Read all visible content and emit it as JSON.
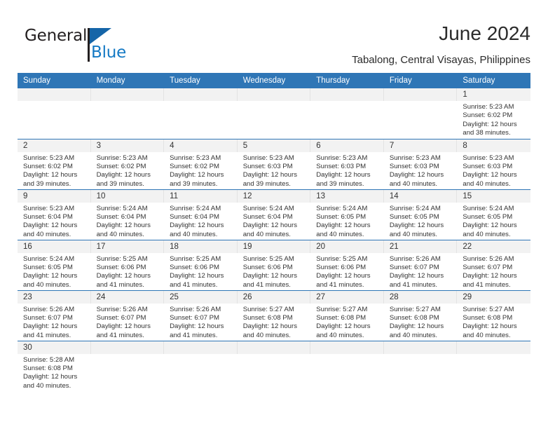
{
  "branding": {
    "logo_primary": "General",
    "logo_secondary": "Blue",
    "logo_flag_icon": "flag-triangle-icon",
    "accent_color": "#2f76b6",
    "logo_blue_color": "#1479c4"
  },
  "header": {
    "title": "June 2024",
    "subtitle": "Tabalong, Central Visayas, Philippines"
  },
  "calendar": {
    "weekday_headers": [
      "Sunday",
      "Monday",
      "Tuesday",
      "Wednesday",
      "Thursday",
      "Friday",
      "Saturday"
    ],
    "weeks": [
      [
        {
          "day": "",
          "empty": true,
          "lines": []
        },
        {
          "day": "",
          "empty": true,
          "lines": []
        },
        {
          "day": "",
          "empty": true,
          "lines": []
        },
        {
          "day": "",
          "empty": true,
          "lines": []
        },
        {
          "day": "",
          "empty": true,
          "lines": []
        },
        {
          "day": "",
          "empty": true,
          "lines": []
        },
        {
          "day": "1",
          "empty": false,
          "lines": [
            "Sunrise: 5:23 AM",
            "Sunset: 6:02 PM",
            "Daylight: 12 hours",
            "and 38 minutes."
          ]
        }
      ],
      [
        {
          "day": "2",
          "empty": false,
          "lines": [
            "Sunrise: 5:23 AM",
            "Sunset: 6:02 PM",
            "Daylight: 12 hours",
            "and 39 minutes."
          ]
        },
        {
          "day": "3",
          "empty": false,
          "lines": [
            "Sunrise: 5:23 AM",
            "Sunset: 6:02 PM",
            "Daylight: 12 hours",
            "and 39 minutes."
          ]
        },
        {
          "day": "4",
          "empty": false,
          "lines": [
            "Sunrise: 5:23 AM",
            "Sunset: 6:02 PM",
            "Daylight: 12 hours",
            "and 39 minutes."
          ]
        },
        {
          "day": "5",
          "empty": false,
          "lines": [
            "Sunrise: 5:23 AM",
            "Sunset: 6:03 PM",
            "Daylight: 12 hours",
            "and 39 minutes."
          ]
        },
        {
          "day": "6",
          "empty": false,
          "lines": [
            "Sunrise: 5:23 AM",
            "Sunset: 6:03 PM",
            "Daylight: 12 hours",
            "and 39 minutes."
          ]
        },
        {
          "day": "7",
          "empty": false,
          "lines": [
            "Sunrise: 5:23 AM",
            "Sunset: 6:03 PM",
            "Daylight: 12 hours",
            "and 40 minutes."
          ]
        },
        {
          "day": "8",
          "empty": false,
          "lines": [
            "Sunrise: 5:23 AM",
            "Sunset: 6:03 PM",
            "Daylight: 12 hours",
            "and 40 minutes."
          ]
        }
      ],
      [
        {
          "day": "9",
          "empty": false,
          "lines": [
            "Sunrise: 5:23 AM",
            "Sunset: 6:04 PM",
            "Daylight: 12 hours",
            "and 40 minutes."
          ]
        },
        {
          "day": "10",
          "empty": false,
          "lines": [
            "Sunrise: 5:24 AM",
            "Sunset: 6:04 PM",
            "Daylight: 12 hours",
            "and 40 minutes."
          ]
        },
        {
          "day": "11",
          "empty": false,
          "lines": [
            "Sunrise: 5:24 AM",
            "Sunset: 6:04 PM",
            "Daylight: 12 hours",
            "and 40 minutes."
          ]
        },
        {
          "day": "12",
          "empty": false,
          "lines": [
            "Sunrise: 5:24 AM",
            "Sunset: 6:04 PM",
            "Daylight: 12 hours",
            "and 40 minutes."
          ]
        },
        {
          "day": "13",
          "empty": false,
          "lines": [
            "Sunrise: 5:24 AM",
            "Sunset: 6:05 PM",
            "Daylight: 12 hours",
            "and 40 minutes."
          ]
        },
        {
          "day": "14",
          "empty": false,
          "lines": [
            "Sunrise: 5:24 AM",
            "Sunset: 6:05 PM",
            "Daylight: 12 hours",
            "and 40 minutes."
          ]
        },
        {
          "day": "15",
          "empty": false,
          "lines": [
            "Sunrise: 5:24 AM",
            "Sunset: 6:05 PM",
            "Daylight: 12 hours",
            "and 40 minutes."
          ]
        }
      ],
      [
        {
          "day": "16",
          "empty": false,
          "lines": [
            "Sunrise: 5:24 AM",
            "Sunset: 6:05 PM",
            "Daylight: 12 hours",
            "and 40 minutes."
          ]
        },
        {
          "day": "17",
          "empty": false,
          "lines": [
            "Sunrise: 5:25 AM",
            "Sunset: 6:06 PM",
            "Daylight: 12 hours",
            "and 41 minutes."
          ]
        },
        {
          "day": "18",
          "empty": false,
          "lines": [
            "Sunrise: 5:25 AM",
            "Sunset: 6:06 PM",
            "Daylight: 12 hours",
            "and 41 minutes."
          ]
        },
        {
          "day": "19",
          "empty": false,
          "lines": [
            "Sunrise: 5:25 AM",
            "Sunset: 6:06 PM",
            "Daylight: 12 hours",
            "and 41 minutes."
          ]
        },
        {
          "day": "20",
          "empty": false,
          "lines": [
            "Sunrise: 5:25 AM",
            "Sunset: 6:06 PM",
            "Daylight: 12 hours",
            "and 41 minutes."
          ]
        },
        {
          "day": "21",
          "empty": false,
          "lines": [
            "Sunrise: 5:26 AM",
            "Sunset: 6:07 PM",
            "Daylight: 12 hours",
            "and 41 minutes."
          ]
        },
        {
          "day": "22",
          "empty": false,
          "lines": [
            "Sunrise: 5:26 AM",
            "Sunset: 6:07 PM",
            "Daylight: 12 hours",
            "and 41 minutes."
          ]
        }
      ],
      [
        {
          "day": "23",
          "empty": false,
          "lines": [
            "Sunrise: 5:26 AM",
            "Sunset: 6:07 PM",
            "Daylight: 12 hours",
            "and 41 minutes."
          ]
        },
        {
          "day": "24",
          "empty": false,
          "lines": [
            "Sunrise: 5:26 AM",
            "Sunset: 6:07 PM",
            "Daylight: 12 hours",
            "and 41 minutes."
          ]
        },
        {
          "day": "25",
          "empty": false,
          "lines": [
            "Sunrise: 5:26 AM",
            "Sunset: 6:07 PM",
            "Daylight: 12 hours",
            "and 41 minutes."
          ]
        },
        {
          "day": "26",
          "empty": false,
          "lines": [
            "Sunrise: 5:27 AM",
            "Sunset: 6:08 PM",
            "Daylight: 12 hours",
            "and 40 minutes."
          ]
        },
        {
          "day": "27",
          "empty": false,
          "lines": [
            "Sunrise: 5:27 AM",
            "Sunset: 6:08 PM",
            "Daylight: 12 hours",
            "and 40 minutes."
          ]
        },
        {
          "day": "28",
          "empty": false,
          "lines": [
            "Sunrise: 5:27 AM",
            "Sunset: 6:08 PM",
            "Daylight: 12 hours",
            "and 40 minutes."
          ]
        },
        {
          "day": "29",
          "empty": false,
          "lines": [
            "Sunrise: 5:27 AM",
            "Sunset: 6:08 PM",
            "Daylight: 12 hours",
            "and 40 minutes."
          ]
        }
      ],
      [
        {
          "day": "30",
          "empty": false,
          "lines": [
            "Sunrise: 5:28 AM",
            "Sunset: 6:08 PM",
            "Daylight: 12 hours",
            "and 40 minutes."
          ]
        },
        {
          "day": "",
          "empty": true,
          "lines": []
        },
        {
          "day": "",
          "empty": true,
          "lines": []
        },
        {
          "day": "",
          "empty": true,
          "lines": []
        },
        {
          "day": "",
          "empty": true,
          "lines": []
        },
        {
          "day": "",
          "empty": true,
          "lines": []
        },
        {
          "day": "",
          "empty": true,
          "lines": []
        }
      ]
    ]
  }
}
